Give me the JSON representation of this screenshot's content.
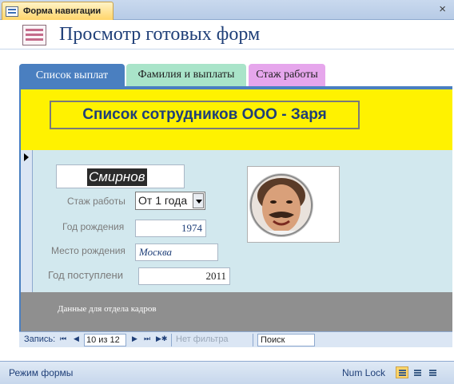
{
  "window": {
    "tab_title": "Форма навигации",
    "close_symbol": "×"
  },
  "header": {
    "title": "Просмотр готовых форм"
  },
  "tabs": [
    {
      "label": "Список выплат",
      "active": true,
      "color": "#4a7fc0"
    },
    {
      "label": "Фамилия и выплаты",
      "active": false,
      "color": "#a9e4c9"
    },
    {
      "label": "Стаж работы",
      "active": false,
      "color": "#e6a6ec"
    }
  ],
  "subform": {
    "title": "Список сотрудников ООО - Заря",
    "surname": "Смирнов",
    "experience_label": "Стаж работы",
    "experience_value": "От 1 года",
    "birth_year_label": "Год рождения",
    "birth_year": "1974",
    "birthplace_label": "Место рождения",
    "birthplace": "Москва",
    "hire_year_label": "Год поступлени",
    "hire_year": "2011",
    "footer_text": "Данные для отдела кадров",
    "colors": {
      "header": "#fff200",
      "body": "#d2e8ee",
      "footer": "#8f8f8f"
    }
  },
  "record_nav": {
    "label": "Запись:",
    "first": "⏮",
    "prev": "◀",
    "current": "10 из 12",
    "next": "▶",
    "last": "⏭",
    "new": "▶✱",
    "filter": "Нет фильтра",
    "search": "Поиск"
  },
  "status": {
    "mode": "Режим формы",
    "num_lock": "Num Lock"
  }
}
